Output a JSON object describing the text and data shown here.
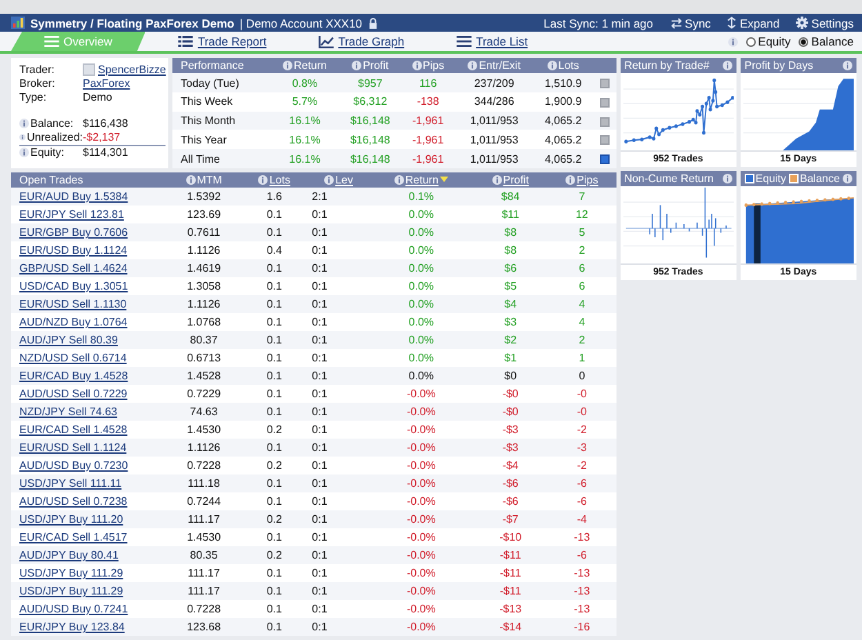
{
  "header": {
    "title": "Symmetry / Floating PaxForex Demo",
    "account": "| Demo Account XXX10",
    "last_sync": "Last Sync: 1 min ago",
    "actions": [
      "Sync",
      "Expand",
      "Settings"
    ]
  },
  "tabs": [
    {
      "label": "Overview",
      "selected": true
    },
    {
      "label": "Trade Report",
      "selected": false
    },
    {
      "label": "Trade Graph",
      "selected": false
    },
    {
      "label": "Trade List",
      "selected": false
    }
  ],
  "view_mode": [
    {
      "label": "Equity",
      "selected": false
    },
    {
      "label": "Balance",
      "selected": true
    }
  ],
  "account": {
    "fields": [
      {
        "label": "Trader:",
        "value": "SpencerBizze",
        "kind": "user"
      },
      {
        "label": "Broker:",
        "value": "PaxForex",
        "kind": "link"
      },
      {
        "label": "Type:",
        "value": "Demo",
        "kind": "text"
      }
    ],
    "totals": [
      {
        "label": "Balance:",
        "value": "$116,438",
        "color": "#111111"
      },
      {
        "label": "Unrealized:",
        "value": "-$2,137",
        "color": "#d11c2a"
      },
      {
        "label": "Equity:",
        "value": "$114,301",
        "color": "#111111"
      }
    ]
  },
  "performance": {
    "columns": [
      {
        "label": "Performance",
        "info": false
      },
      {
        "label": "Return",
        "info": true
      },
      {
        "label": "Profit",
        "info": true
      },
      {
        "label": "Pips",
        "info": true
      },
      {
        "label": "Entr/Exit",
        "info": true
      },
      {
        "label": "Lots",
        "info": true
      }
    ],
    "rows": [
      {
        "period": "Today (Tue)",
        "return": "0.8%",
        "profit": "$957",
        "pips": {
          "text": "116",
          "color": "#23a023"
        },
        "entry_exit": "237/209",
        "lots": "1,510.9",
        "color": "#23a023",
        "selected": false
      },
      {
        "period": "This Week",
        "return": "5.7%",
        "profit": "$6,312",
        "pips": {
          "text": "-138",
          "color": "#d11c2a"
        },
        "entry_exit": "344/286",
        "lots": "1,900.9",
        "color": "#23a023",
        "selected": false
      },
      {
        "period": "This Month",
        "return": "16.1%",
        "profit": "$16,148",
        "pips": {
          "text": "-1,961",
          "color": "#d11c2a"
        },
        "entry_exit": "1,011/953",
        "lots": "4,065.2",
        "color": "#23a023",
        "selected": false
      },
      {
        "period": "This Year",
        "return": "16.1%",
        "profit": "$16,148",
        "pips": {
          "text": "-1,961",
          "color": "#d11c2a"
        },
        "entry_exit": "1,011/953",
        "lots": "4,065.2",
        "color": "#23a023",
        "selected": false
      },
      {
        "period": "All Time",
        "return": "16.1%",
        "profit": "$16,148",
        "pips": {
          "text": "-1,961",
          "color": "#d11c2a"
        },
        "entry_exit": "1,011/953",
        "lots": "4,065.2",
        "color": "#23a023",
        "selected": true
      }
    ]
  },
  "open_trades": {
    "columns": [
      {
        "label": "Open Trades",
        "info": false,
        "sortable": false,
        "sorted": false
      },
      {
        "label": "MTM",
        "info": true,
        "sortable": false,
        "sorted": false
      },
      {
        "label": "Lots",
        "info": true,
        "sortable": true,
        "sorted": false
      },
      {
        "label": "Lev",
        "info": true,
        "sortable": true,
        "sorted": false
      },
      {
        "label": "Return",
        "info": true,
        "sortable": true,
        "sorted": true
      },
      {
        "label": "Profit",
        "info": true,
        "sortable": true,
        "sorted": false
      },
      {
        "label": "Pips",
        "info": true,
        "sortable": true,
        "sorted": false
      }
    ],
    "rows": [
      {
        "trade": "EUR/AUD Buy 1.5384",
        "mtm": "1.5392",
        "lots": "1.6",
        "lev": "2:1",
        "return": "0.1%",
        "profit": "$84",
        "pips": "7",
        "color": "#23a023"
      },
      {
        "trade": "EUR/JPY Sell 123.81",
        "mtm": "123.69",
        "lots": "0.1",
        "lev": "0:1",
        "return": "0.0%",
        "profit": "$11",
        "pips": "12",
        "color": "#23a023"
      },
      {
        "trade": "EUR/GBP Buy 0.7606",
        "mtm": "0.7611",
        "lots": "0.1",
        "lev": "0:1",
        "return": "0.0%",
        "profit": "$8",
        "pips": "5",
        "color": "#23a023"
      },
      {
        "trade": "EUR/USD Buy 1.1124",
        "mtm": "1.1126",
        "lots": "0.4",
        "lev": "0:1",
        "return": "0.0%",
        "profit": "$8",
        "pips": "2",
        "color": "#23a023"
      },
      {
        "trade": "GBP/USD Sell 1.4624",
        "mtm": "1.4619",
        "lots": "0.1",
        "lev": "0:1",
        "return": "0.0%",
        "profit": "$6",
        "pips": "6",
        "color": "#23a023"
      },
      {
        "trade": "USD/CAD Buy 1.3051",
        "mtm": "1.3058",
        "lots": "0.1",
        "lev": "0:1",
        "return": "0.0%",
        "profit": "$5",
        "pips": "6",
        "color": "#23a023"
      },
      {
        "trade": "EUR/USD Sell 1.1130",
        "mtm": "1.1126",
        "lots": "0.1",
        "lev": "0:1",
        "return": "0.0%",
        "profit": "$4",
        "pips": "4",
        "color": "#23a023"
      },
      {
        "trade": "AUD/NZD Buy 1.0764",
        "mtm": "1.0768",
        "lots": "0.1",
        "lev": "0:1",
        "return": "0.0%",
        "profit": "$3",
        "pips": "4",
        "color": "#23a023"
      },
      {
        "trade": "AUD/JPY Sell 80.39",
        "mtm": "80.37",
        "lots": "0.1",
        "lev": "0:1",
        "return": "0.0%",
        "profit": "$2",
        "pips": "2",
        "color": "#23a023"
      },
      {
        "trade": "NZD/USD Sell 0.6714",
        "mtm": "0.6713",
        "lots": "0.1",
        "lev": "0:1",
        "return": "0.0%",
        "profit": "$1",
        "pips": "1",
        "color": "#23a023"
      },
      {
        "trade": "EUR/CAD Buy 1.4528",
        "mtm": "1.4528",
        "lots": "0.1",
        "lev": "0:1",
        "return": "0.0%",
        "profit": "$0",
        "pips": "0",
        "color": "#111111"
      },
      {
        "trade": "AUD/USD Sell 0.7229",
        "mtm": "0.7229",
        "lots": "0.1",
        "lev": "0:1",
        "return": "-0.0%",
        "profit": "-$0",
        "pips": "-0",
        "color": "#d11c2a"
      },
      {
        "trade": "NZD/JPY Sell 74.63",
        "mtm": "74.63",
        "lots": "0.1",
        "lev": "0:1",
        "return": "-0.0%",
        "profit": "-$0",
        "pips": "-0",
        "color": "#d11c2a"
      },
      {
        "trade": "EUR/CAD Sell 1.4528",
        "mtm": "1.4530",
        "lots": "0.2",
        "lev": "0:1",
        "return": "-0.0%",
        "profit": "-$3",
        "pips": "-2",
        "color": "#d11c2a"
      },
      {
        "trade": "EUR/USD Sell 1.1124",
        "mtm": "1.1126",
        "lots": "0.1",
        "lev": "0:1",
        "return": "-0.0%",
        "profit": "-$3",
        "pips": "-3",
        "color": "#d11c2a"
      },
      {
        "trade": "AUD/USD Buy 0.7230",
        "mtm": "0.7228",
        "lots": "0.2",
        "lev": "0:1",
        "return": "-0.0%",
        "profit": "-$4",
        "pips": "-2",
        "color": "#d11c2a"
      },
      {
        "trade": "USD/JPY Sell 111.11",
        "mtm": "111.18",
        "lots": "0.1",
        "lev": "0:1",
        "return": "-0.0%",
        "profit": "-$6",
        "pips": "-6",
        "color": "#d11c2a"
      },
      {
        "trade": "AUD/USD Sell 0.7238",
        "mtm": "0.7244",
        "lots": "0.1",
        "lev": "0:1",
        "return": "-0.0%",
        "profit": "-$6",
        "pips": "-6",
        "color": "#d11c2a"
      },
      {
        "trade": "USD/JPY Buy 111.20",
        "mtm": "111.17",
        "lots": "0.2",
        "lev": "0:1",
        "return": "-0.0%",
        "profit": "-$7",
        "pips": "-4",
        "color": "#d11c2a"
      },
      {
        "trade": "EUR/CAD Sell 1.4517",
        "mtm": "1.4530",
        "lots": "0.1",
        "lev": "0:1",
        "return": "-0.0%",
        "profit": "-$10",
        "pips": "-13",
        "color": "#d11c2a"
      },
      {
        "trade": "AUD/JPY Buy 80.41",
        "mtm": "80.35",
        "lots": "0.2",
        "lev": "0:1",
        "return": "-0.0%",
        "profit": "-$11",
        "pips": "-6",
        "color": "#d11c2a"
      },
      {
        "trade": "USD/JPY Buy 111.29",
        "mtm": "111.17",
        "lots": "0.1",
        "lev": "0:1",
        "return": "-0.0%",
        "profit": "-$11",
        "pips": "-13",
        "color": "#d11c2a"
      },
      {
        "trade": "USD/JPY Buy 111.29",
        "mtm": "111.17",
        "lots": "0.1",
        "lev": "0:1",
        "return": "-0.0%",
        "profit": "-$11",
        "pips": "-13",
        "color": "#d11c2a"
      },
      {
        "trade": "AUD/USD Buy 0.7241",
        "mtm": "0.7228",
        "lots": "0.1",
        "lev": "0:1",
        "return": "-0.0%",
        "profit": "-$13",
        "pips": "-13",
        "color": "#d11c2a"
      },
      {
        "trade": "EUR/JPY Buy 123.84",
        "mtm": "123.68",
        "lots": "0.1",
        "lev": "0:1",
        "return": "-0.0%",
        "profit": "-$14",
        "pips": "-16",
        "color": "#d11c2a"
      }
    ]
  },
  "charts": [
    {
      "kind": "line",
      "title": "Return by Trade#",
      "footer": "952 Trades"
    },
    {
      "kind": "area",
      "title": "Profit by Days",
      "footer": "15 Days"
    },
    {
      "kind": "spikes",
      "title": "Non-Cume Return",
      "footer": "952 Trades"
    },
    {
      "kind": "equity",
      "legend": [
        {
          "label": "Equity",
          "color": "#2f6fd0"
        },
        {
          "label": "Balance",
          "color": "#e8a15a"
        }
      ],
      "footer": "15 Days"
    }
  ]
}
